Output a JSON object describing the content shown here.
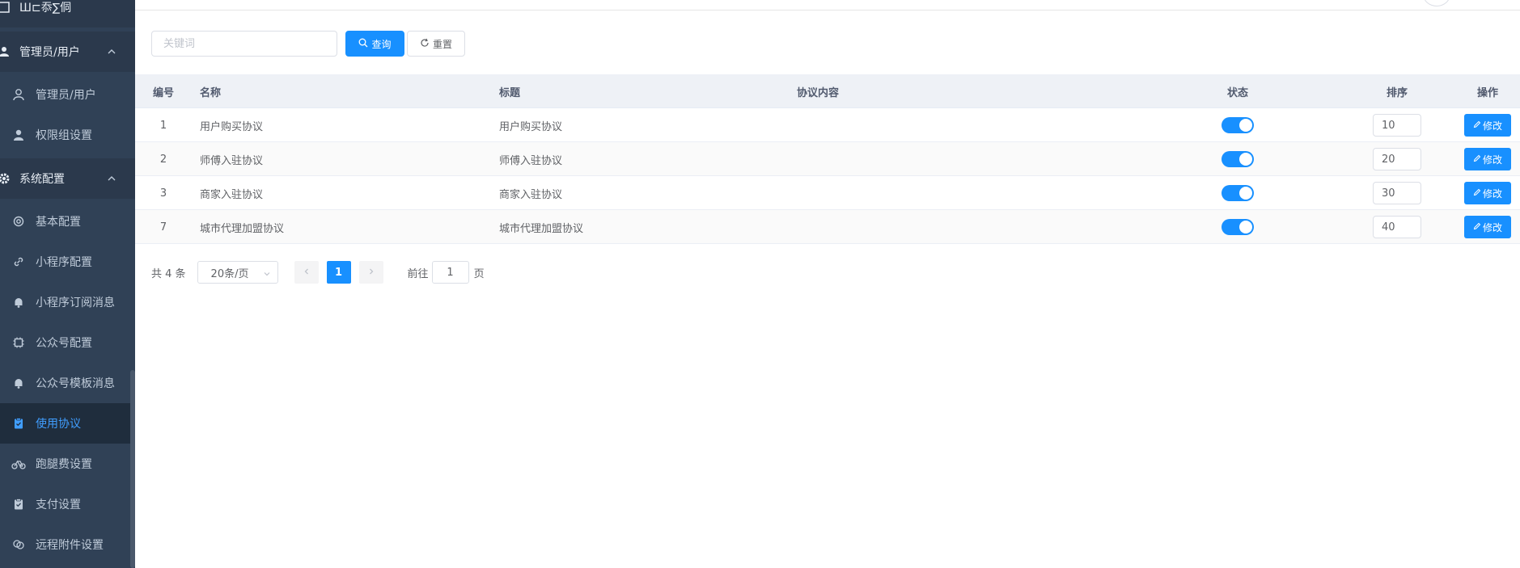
{
  "sidebar": {
    "partial_top_label": "Ш⊏忝∑侗",
    "groups": [
      {
        "label": "管理员/用户"
      },
      {
        "label": "系统配置"
      }
    ],
    "items": [
      {
        "label": "管理员/用户",
        "icon": "user-icon"
      },
      {
        "label": "权限组设置",
        "icon": "user-solid-icon"
      },
      {
        "label": "基本配置",
        "icon": "gear-icon"
      },
      {
        "label": "小程序配置",
        "icon": "link-icon"
      },
      {
        "label": "小程序订阅消息",
        "icon": "bell-icon"
      },
      {
        "label": "公众号配置",
        "icon": "chip-icon"
      },
      {
        "label": "公众号模板消息",
        "icon": "bell-icon"
      },
      {
        "label": "使用协议",
        "icon": "clipboard-icon",
        "active": true
      },
      {
        "label": "跑腿费设置",
        "icon": "bicycle-icon"
      },
      {
        "label": "支付设置",
        "icon": "clipboard-icon"
      },
      {
        "label": "远程附件设置",
        "icon": "copy-icon"
      }
    ]
  },
  "search": {
    "placeholder": "关键词",
    "value": "",
    "query_label": "查询",
    "reset_label": "重置"
  },
  "table": {
    "headers": {
      "id": "编号",
      "name": "名称",
      "title": "标题",
      "content": "协议内容",
      "status": "状态",
      "sort": "排序",
      "op": "操作"
    },
    "edit_label": "修改",
    "rows": [
      {
        "id": "1",
        "name": "用户购买协议",
        "title": "用户购买协议",
        "content": "",
        "status": true,
        "sort": "10"
      },
      {
        "id": "2",
        "name": "师傅入驻协议",
        "title": "师傅入驻协议",
        "content": "",
        "status": true,
        "sort": "20"
      },
      {
        "id": "3",
        "name": "商家入驻协议",
        "title": "商家入驻协议",
        "content": "",
        "status": true,
        "sort": "30"
      },
      {
        "id": "7",
        "name": "城市代理加盟协议",
        "title": "城市代理加盟协议",
        "content": "",
        "status": true,
        "sort": "40"
      }
    ]
  },
  "pagination": {
    "total": "共 4 条",
    "page_size": "20条/页",
    "current": "1",
    "goto_prefix": "前往",
    "goto_value": "1",
    "goto_suffix": "页"
  },
  "colors": {
    "sidebar_bg": "#304156",
    "sidebar_active_bg": "#1f2d3d",
    "accent": "#1890ff",
    "active_text": "#409eff"
  }
}
